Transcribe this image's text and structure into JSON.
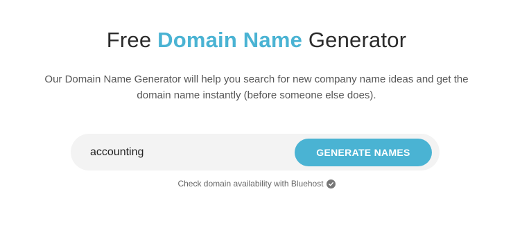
{
  "hero": {
    "title_prefix": "Free ",
    "title_accent": "Domain Name",
    "title_suffix": " Generator",
    "description_line1": "Our Domain Name Generator will help you search for new company name ideas and get the",
    "description_line2": "domain name instantly (before someone else does)."
  },
  "search": {
    "value": "accounting",
    "button_label": "GENERATE NAMES"
  },
  "availability": {
    "text": "Check domain availability with Bluehost",
    "icon": "check-circle-icon"
  },
  "colors": {
    "accent": "#4ab3d3",
    "search_bg": "#f3f3f3",
    "title_text": "#2b2b2b",
    "body_text": "#555555"
  }
}
